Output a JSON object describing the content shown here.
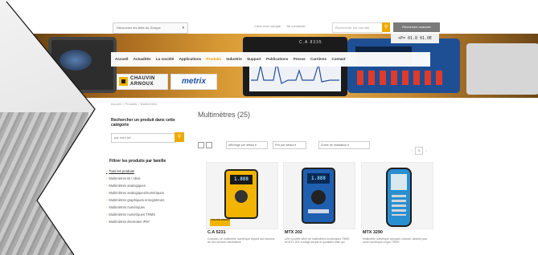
{
  "topbar": {
    "country_label": "Découvrez les sites du Groupe",
    "links": [
      "Créer mon compte",
      "Se connecter"
    ],
    "search_placeholder": "Rechercher sur nos site",
    "advanced_search": "Recherche avancée"
  },
  "banner": {
    "model_label": "C.A 8335",
    "readout": "+P= 01.8 01.0E"
  },
  "nav": {
    "items": [
      "Accueil",
      "Actualités",
      "La société",
      "Applications",
      "Produits",
      "Industrie",
      "Support",
      "Publications",
      "Presse",
      "Carrières",
      "Contact"
    ],
    "active": "Produits"
  },
  "logos": {
    "ca_line1": "CHAUVIN",
    "ca_line2": "ARNOUX",
    "metrix": "metrix"
  },
  "breadcrumb": "Accueil > Produits > Multimètres",
  "sidebar": {
    "search_title": "Rechercher un produit dans cette catégorie",
    "search_placeholder": "par nom ref",
    "filter_title": "Filtrer les produits par famille",
    "families": [
      "Tous les produits",
      "Multimètres Bi / Abvs",
      "Multimètres analogiques",
      "Multimètres analogiques/numériques",
      "Multimètres graphiques enregistreurs",
      "Multimètres numériques",
      "Multimètres numériques TRMS",
      "Multimètres électrotes IP67"
    ]
  },
  "main": {
    "title": "Multimètres (25)",
    "sort_options": [
      "Affichage par défaut",
      "Prix par défaut",
      "Durée de réalisation"
    ],
    "pager": {
      "prev": "‹",
      "current": "1",
      "next": "›"
    }
  },
  "products": [
    {
      "name": "C.A 5231",
      "desc": "Compact, ce multimètre numérique répond aux besoins de tout services électriciens",
      "lcd": "1.888",
      "brand": "CHAUVIN ARNOUX"
    },
    {
      "name": "MTX 202",
      "desc": "Une nouvelle série de multimètres numériques TRMS 6k MTX 20X à usage simple et quotidien mais qui",
      "lcd": "1.888"
    },
    {
      "name": "MTX 3290",
      "desc": "Multimètre numérique compact, robuste, destiné pour notre numérique à type TRMS",
      "lcd": ""
    }
  ],
  "colors": {
    "accent": "#f0a800",
    "nav_active": "#e59b00",
    "metrix_blue": "#1b4ea1"
  }
}
